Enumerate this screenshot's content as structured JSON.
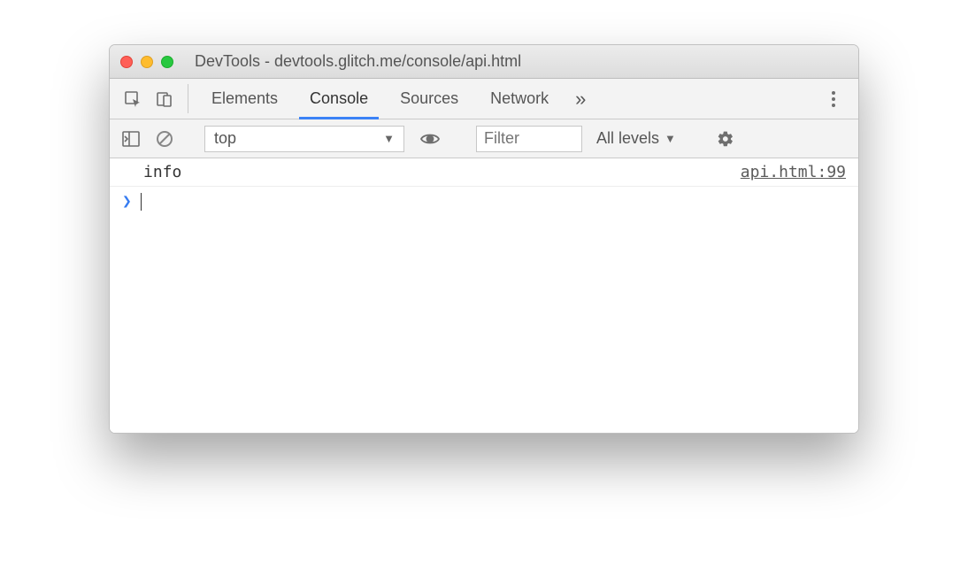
{
  "window_title": "DevTools - devtools.glitch.me/console/api.html",
  "tabs": {
    "elements": "Elements",
    "console": "Console",
    "sources": "Sources",
    "network": "Network",
    "active": "Console"
  },
  "filter_bar": {
    "context": "top",
    "filter_placeholder": "Filter",
    "levels": "All levels"
  },
  "console": {
    "rows": [
      {
        "message": "info",
        "source": "api.html:99"
      }
    ]
  }
}
